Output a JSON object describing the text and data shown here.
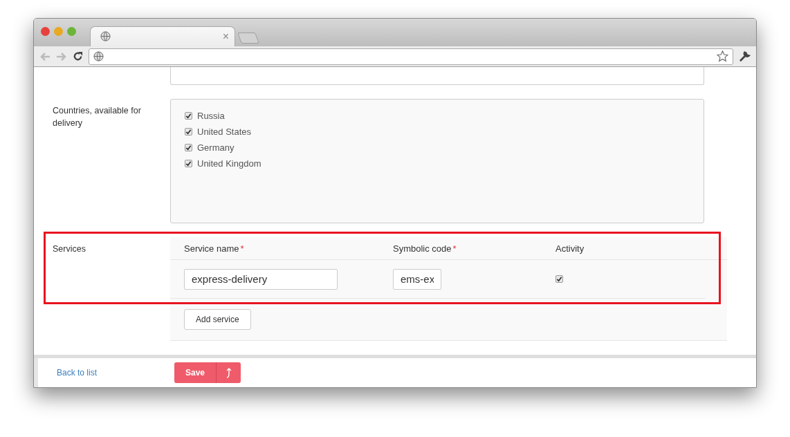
{
  "browser": {
    "tab_close": "×"
  },
  "countries": {
    "label": "Countries, available for delivery",
    "options": [
      {
        "label": "Russia",
        "checked": true
      },
      {
        "label": "United States",
        "checked": true
      },
      {
        "label": "Germany",
        "checked": true
      },
      {
        "label": "United Kingdom",
        "checked": true
      }
    ]
  },
  "services": {
    "label": "Services",
    "highlighted": true,
    "columns": [
      {
        "label": "Service name",
        "required_mark": "*"
      },
      {
        "label": "Symbolic code",
        "required_mark": "*"
      },
      {
        "label": "Activity"
      }
    ],
    "rows": [
      {
        "service_name": "express-delivery",
        "symbolic_code": "ems-ex",
        "active": true
      }
    ],
    "add_button": "Add service"
  },
  "footer": {
    "back_link": "Back to list",
    "save_button": "Save"
  }
}
